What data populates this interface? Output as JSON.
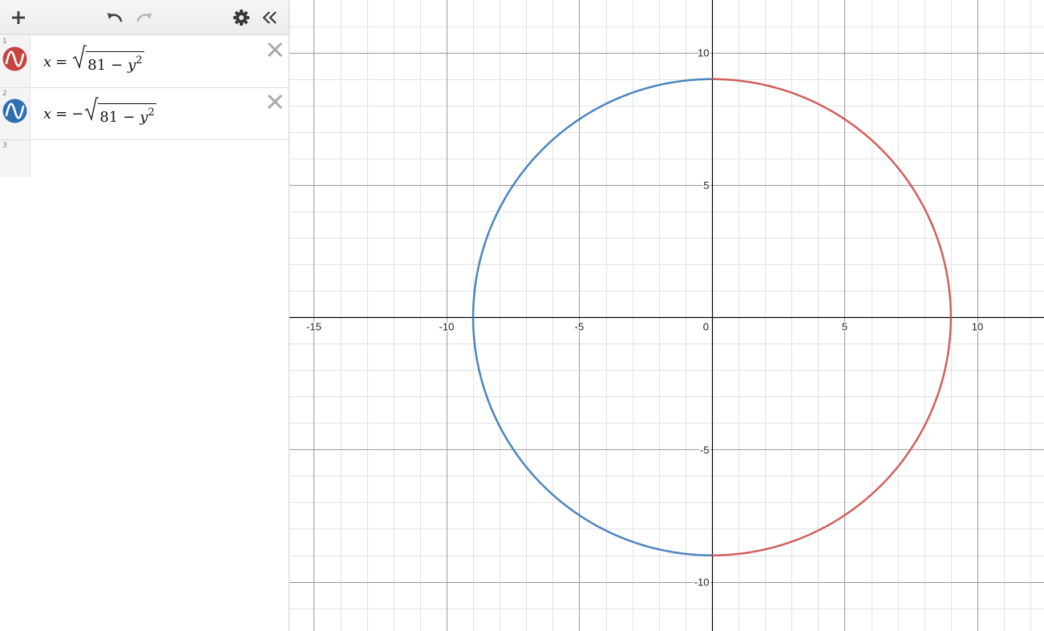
{
  "toolbar": {
    "add_icon": "plus-icon",
    "undo_icon": "undo-icon",
    "redo_icon": "redo-icon",
    "settings_icon": "gear-icon",
    "collapse_icon": "double-chevron-left-icon"
  },
  "expressions": [
    {
      "index": "1",
      "color": "#c74440",
      "lhs": "x",
      "eq": "=",
      "sign": "",
      "radicand": "81",
      "minus": "−",
      "var": "y",
      "exp": "2",
      "side": 1
    },
    {
      "index": "2",
      "color": "#2d70b3",
      "lhs": "x",
      "eq": "=",
      "sign": "−",
      "radicand": "81",
      "minus": "−",
      "var": "y",
      "exp": "2",
      "side": -1
    },
    {
      "index": "3"
    }
  ],
  "graph": {
    "x_range": [
      -15.92,
      12.51
    ],
    "y_range": [
      -11.86,
      11.99
    ],
    "major_step": 5,
    "minor_step": 1,
    "x_tick_labels": [
      "-15",
      "-10",
      "-5",
      "0",
      "5",
      "10"
    ],
    "y_tick_labels": [
      "10",
      "5",
      "-5",
      "-10"
    ],
    "axis_color": "#000000",
    "major_grid_color": "#9a9a9a",
    "minor_grid_color": "#e2e2e2",
    "curves": [
      {
        "name": "x = sqrt(81 - y^2)",
        "color": "#c74440",
        "radius": 9,
        "side": 1
      },
      {
        "name": "x = -sqrt(81 - y^2)",
        "color": "#2d70b3",
        "radius": 9,
        "side": -1
      }
    ]
  }
}
